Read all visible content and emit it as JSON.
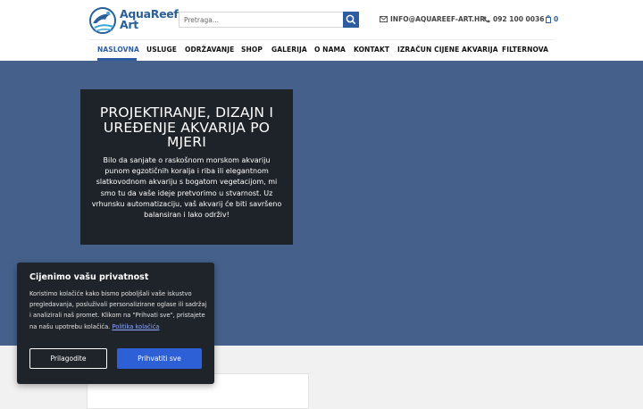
{
  "colors": {
    "brand": "#2d5d9f",
    "hero_bg": "#45618b",
    "dark_box": "#1e2329",
    "cookie_bg": "#1f242a",
    "accept_button": "#2d5fd6"
  },
  "header": {
    "logo": {
      "line1": "AquaReef",
      "line2": "Art",
      "icon": "dolphin-logo-icon"
    },
    "search": {
      "placeholder": "Pretraga...",
      "value": "",
      "icon": "search-icon"
    },
    "email": {
      "icon": "envelope-icon",
      "text": "INFO@AQUAREEF-ART.HR"
    },
    "phone": {
      "icon": "phone-icon",
      "text": "092 100 0036"
    },
    "cart": {
      "icon": "cart-icon",
      "count": "0"
    }
  },
  "nav": {
    "items": [
      {
        "label": "NASLOVNA",
        "active": true
      },
      {
        "label": "USLUGE"
      },
      {
        "label": "ODRŽAVANJE"
      },
      {
        "label": "SHOP"
      },
      {
        "label": "GALERIJA"
      },
      {
        "label": "O NAMA"
      },
      {
        "label": "KONTAKT"
      },
      {
        "label": "IZRAČUN CIJENE AKVARIJA"
      },
      {
        "label": "FILTERNOVA"
      }
    ]
  },
  "hero": {
    "title": "PROJEKTIRANJE, DIZAJN I UREĐENJE AKVARIJA PO MJERI",
    "text": "Bilo da sanjate o raskošnom morskom akvariju punom egzotičnih koralja i riba ili elegantnom slatkovodnom akvariju s bogatom vegetacijom, mi smo tu da vaše ideje pretvorimo u stvarnost. Uz vrhunsku automatizaciju, vaš akvarij će biti savršeno balansiran i lako održiv!"
  },
  "cookie": {
    "title": "Cijenimo vašu privatnost",
    "text": "Koristimo kolačiće kako bismo poboljšali vaše iskustvo pregledavanja, posluživali personalizirane oglase ili sadržaj i analizirali naš promet. Klikom na \"Prihvati sve\", pristajete na našu upotrebu kolačića.",
    "link": "Politika kolačića",
    "customize_label": "Prilagodite",
    "accept_label": "Prihvatiti sve"
  }
}
